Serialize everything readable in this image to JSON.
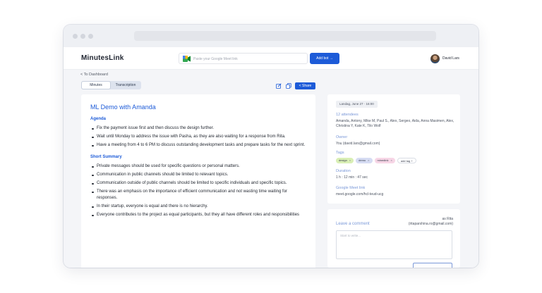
{
  "app": {
    "logo": "MinutesLink",
    "url_placeholder": "Paste your Google Meet link",
    "add_bot_label": "Add bot →",
    "user_name": "David Lars"
  },
  "breadcrumb": "< To Dashboard",
  "tabs": [
    "Minutes",
    "Transcription"
  ],
  "share_label": "Share",
  "meeting": {
    "title": "ML Demo with Amanda",
    "agenda_heading": "Agenda",
    "agenda": [
      "Fix the payment issue first and then discuss the design further.",
      "Wait until Monday to address the issue with Pasha, as they are also waiting for a response from Rita.",
      "Have a meeting from 4 to 6 PM to discuss outstanding development tasks and prepare tasks for the next sprint."
    ],
    "summary_heading": "Short Summary",
    "summary": [
      "Private messages should be used for specific questions or personal matters.",
      "Communication in public channels should be limited to relevant topics.",
      "Communication outside of public channels should be limited to specific individuals and specific topics.",
      "There was an emphasis on the importance of efficient communication and not wasting time waiting for responses.",
      "In their startup, everyone is equal and there is no hierarchy.",
      "Everyone contributes to the project as equal participants, but they all have different roles and responsibilities"
    ]
  },
  "details": {
    "date": "Landag, June 27 · 16:00",
    "attendees_label": "12 attendees",
    "attendees": "Amanda, Antony, Mike M, Paul S., Alex, Sergeo, Aida, Anna Masimen, Alex, Christina Y, Kate K, Tilo Wolf",
    "owner_label": "Owner",
    "owner": "You (david.lars@gmail.com)",
    "tags_label": "Tags",
    "tags": [
      {
        "name": "design",
        "color": "#d9efb5"
      },
      {
        "name": "demo",
        "color": "#d6dcf3"
      },
      {
        "name": "minedink",
        "color": "#f7d6e6"
      }
    ],
    "add_tag": "add tag +",
    "duration_label": "Duration",
    "duration": "1 h : 12 min : 47 sec",
    "meet_label": "Google Meet link",
    "meet_link": "meet.google.com/hcl-teud-ucg"
  },
  "comment": {
    "leave_label": "Leave a comment",
    "as_line1": "as Rita",
    "as_line2": "(ritaparshina.ro@gmail.com)",
    "placeholder": "Start to write..."
  }
}
